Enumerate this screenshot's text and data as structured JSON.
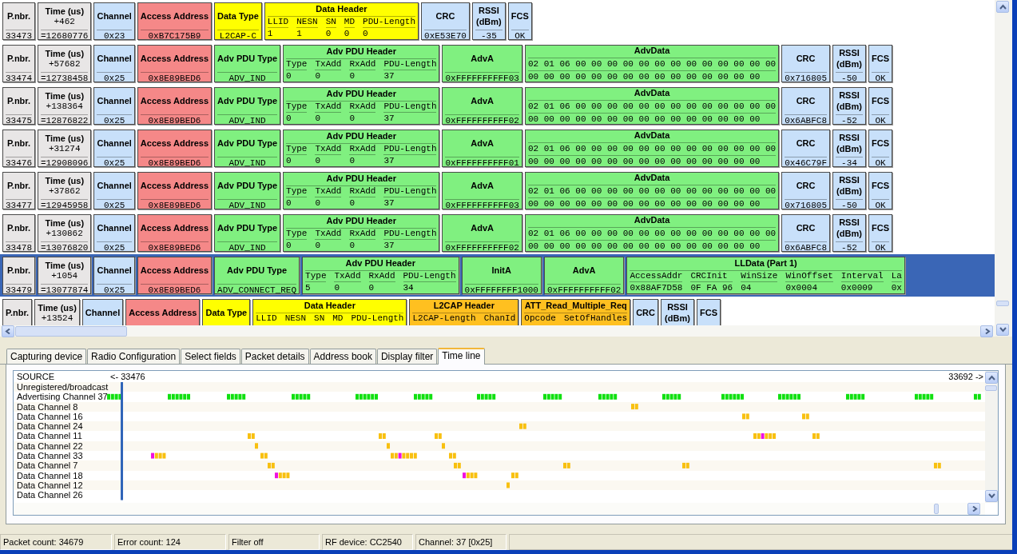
{
  "packets": [
    {
      "selected": false,
      "fields": [
        {
          "kind": "plain",
          "color": "#e8e6e6",
          "title": "P.nbr.",
          "value": "33473"
        },
        {
          "kind": "plain",
          "color": "#e8e6e6",
          "title": "Time (us)",
          "lines": [
            "+462"
          ],
          "value": "=12680776"
        },
        {
          "kind": "plain",
          "color": "#c8e0fa",
          "title": "Channel",
          "value": "0x23"
        },
        {
          "kind": "plain",
          "color": "#f58888",
          "title": "Access Address",
          "value": "0xB7C175B9"
        },
        {
          "kind": "plain",
          "color": "#ffff00",
          "title": "Data Type",
          "value": "L2CAP-C"
        },
        {
          "kind": "grid",
          "color": "#ffff00",
          "title": "Data Header",
          "columns": [
            {
              "label": "LLID",
              "value": "1"
            },
            {
              "label": "NESN",
              "value": "1"
            },
            {
              "label": "SN",
              "value": "0"
            },
            {
              "label": "MD",
              "value": "0"
            },
            {
              "label": "PDU-Length",
              "value": "0"
            }
          ]
        },
        {
          "kind": "plain",
          "color": "#c8e0fa",
          "title": "CRC",
          "value": "0xE53E70"
        },
        {
          "kind": "plain",
          "color": "#c8e0fa",
          "title": "RSSI (dBm)",
          "value": "-35"
        },
        {
          "kind": "plain",
          "color": "#c8e0fa",
          "title": "FCS",
          "value": "OK"
        }
      ]
    },
    {
      "selected": false,
      "fields": [
        {
          "kind": "plain",
          "color": "#e8e6e6",
          "title": "P.nbr.",
          "value": "33474"
        },
        {
          "kind": "plain",
          "color": "#e8e6e6",
          "title": "Time (us)",
          "lines": [
            "+57682"
          ],
          "value": "=12738458"
        },
        {
          "kind": "plain",
          "color": "#c8e0fa",
          "title": "Channel",
          "value": "0x25"
        },
        {
          "kind": "plain",
          "color": "#f58888",
          "title": "Access Address",
          "value": "0x8E89BED6"
        },
        {
          "kind": "plain",
          "color": "#80f080",
          "title": "Adv PDU Type",
          "value": "ADV_IND"
        },
        {
          "kind": "grid",
          "color": "#80f080",
          "title": "Adv PDU Header",
          "columns": [
            {
              "label": "Type",
              "value": "0"
            },
            {
              "label": "TxAdd",
              "value": "0"
            },
            {
              "label": "RxAdd",
              "value": "0"
            },
            {
              "label": "PDU-Length",
              "value": "37"
            }
          ]
        },
        {
          "kind": "plain",
          "color": "#80f080",
          "title": "AdvA",
          "value": "0xFFFFFFFFFF03"
        },
        {
          "kind": "hex",
          "color": "#80f080",
          "title": "AdvData",
          "lines": [
            "02 01 06 00 00 00 00 00 00 00 00 00 00 00 00 00",
            "00 00 00 00 00 00 00 00 00 00 00 00 00 00 00"
          ]
        },
        {
          "kind": "plain",
          "color": "#c8e0fa",
          "title": "CRC",
          "value": "0x716805"
        },
        {
          "kind": "plain",
          "color": "#c8e0fa",
          "title": "RSSI (dBm)",
          "value": "-50"
        },
        {
          "kind": "plain",
          "color": "#c8e0fa",
          "title": "FCS",
          "value": "OK"
        }
      ]
    },
    {
      "selected": false,
      "fields": [
        {
          "kind": "plain",
          "color": "#e8e6e6",
          "title": "P.nbr.",
          "value": "33475"
        },
        {
          "kind": "plain",
          "color": "#e8e6e6",
          "title": "Time (us)",
          "lines": [
            "+138364"
          ],
          "value": "=12876822"
        },
        {
          "kind": "plain",
          "color": "#c8e0fa",
          "title": "Channel",
          "value": "0x25"
        },
        {
          "kind": "plain",
          "color": "#f58888",
          "title": "Access Address",
          "value": "0x8E89BED6"
        },
        {
          "kind": "plain",
          "color": "#80f080",
          "title": "Adv PDU Type",
          "value": "ADV_IND"
        },
        {
          "kind": "grid",
          "color": "#80f080",
          "title": "Adv PDU Header",
          "columns": [
            {
              "label": "Type",
              "value": "0"
            },
            {
              "label": "TxAdd",
              "value": "0"
            },
            {
              "label": "RxAdd",
              "value": "0"
            },
            {
              "label": "PDU-Length",
              "value": "37"
            }
          ]
        },
        {
          "kind": "plain",
          "color": "#80f080",
          "title": "AdvA",
          "value": "0xFFFFFFFFFF02"
        },
        {
          "kind": "hex",
          "color": "#80f080",
          "title": "AdvData",
          "lines": [
            "02 01 06 00 00 00 00 00 00 00 00 00 00 00 00 00",
            "00 00 00 00 00 00 00 00 00 00 00 00 00 00 00"
          ]
        },
        {
          "kind": "plain",
          "color": "#c8e0fa",
          "title": "CRC",
          "value": "0x6ABFC8"
        },
        {
          "kind": "plain",
          "color": "#c8e0fa",
          "title": "RSSI (dBm)",
          "value": "-52"
        },
        {
          "kind": "plain",
          "color": "#c8e0fa",
          "title": "FCS",
          "value": "OK"
        }
      ]
    },
    {
      "selected": false,
      "fields": [
        {
          "kind": "plain",
          "color": "#e8e6e6",
          "title": "P.nbr.",
          "value": "33476"
        },
        {
          "kind": "plain",
          "color": "#e8e6e6",
          "title": "Time (us)",
          "lines": [
            "+31274"
          ],
          "value": "=12908096"
        },
        {
          "kind": "plain",
          "color": "#c8e0fa",
          "title": "Channel",
          "value": "0x25"
        },
        {
          "kind": "plain",
          "color": "#f58888",
          "title": "Access Address",
          "value": "0x8E89BED6"
        },
        {
          "kind": "plain",
          "color": "#80f080",
          "title": "Adv PDU Type",
          "value": "ADV_IND"
        },
        {
          "kind": "grid",
          "color": "#80f080",
          "title": "Adv PDU Header",
          "columns": [
            {
              "label": "Type",
              "value": "0"
            },
            {
              "label": "TxAdd",
              "value": "0"
            },
            {
              "label": "RxAdd",
              "value": "0"
            },
            {
              "label": "PDU-Length",
              "value": "37"
            }
          ]
        },
        {
          "kind": "plain",
          "color": "#80f080",
          "title": "AdvA",
          "value": "0xFFFFFFFFFF01"
        },
        {
          "kind": "hex",
          "color": "#80f080",
          "title": "AdvData",
          "lines": [
            "02 01 06 00 00 00 00 00 00 00 00 00 00 00 00 00",
            "00 00 00 00 00 00 00 00 00 00 00 00 00 00 00"
          ]
        },
        {
          "kind": "plain",
          "color": "#c8e0fa",
          "title": "CRC",
          "value": "0x46C79F"
        },
        {
          "kind": "plain",
          "color": "#c8e0fa",
          "title": "RSSI (dBm)",
          "value": "-34"
        },
        {
          "kind": "plain",
          "color": "#c8e0fa",
          "title": "FCS",
          "value": "OK"
        }
      ]
    },
    {
      "selected": false,
      "fields": [
        {
          "kind": "plain",
          "color": "#e8e6e6",
          "title": "P.nbr.",
          "value": "33477"
        },
        {
          "kind": "plain",
          "color": "#e8e6e6",
          "title": "Time (us)",
          "lines": [
            "+37862"
          ],
          "value": "=12945958"
        },
        {
          "kind": "plain",
          "color": "#c8e0fa",
          "title": "Channel",
          "value": "0x25"
        },
        {
          "kind": "plain",
          "color": "#f58888",
          "title": "Access Address",
          "value": "0x8E89BED6"
        },
        {
          "kind": "plain",
          "color": "#80f080",
          "title": "Adv PDU Type",
          "value": "ADV_IND"
        },
        {
          "kind": "grid",
          "color": "#80f080",
          "title": "Adv PDU Header",
          "columns": [
            {
              "label": "Type",
              "value": "0"
            },
            {
              "label": "TxAdd",
              "value": "0"
            },
            {
              "label": "RxAdd",
              "value": "0"
            },
            {
              "label": "PDU-Length",
              "value": "37"
            }
          ]
        },
        {
          "kind": "plain",
          "color": "#80f080",
          "title": "AdvA",
          "value": "0xFFFFFFFFFF03"
        },
        {
          "kind": "hex",
          "color": "#80f080",
          "title": "AdvData",
          "lines": [
            "02 01 06 00 00 00 00 00 00 00 00 00 00 00 00 00",
            "00 00 00 00 00 00 00 00 00 00 00 00 00 00 00"
          ]
        },
        {
          "kind": "plain",
          "color": "#c8e0fa",
          "title": "CRC",
          "value": "0x716805"
        },
        {
          "kind": "plain",
          "color": "#c8e0fa",
          "title": "RSSI (dBm)",
          "value": "-50"
        },
        {
          "kind": "plain",
          "color": "#c8e0fa",
          "title": "FCS",
          "value": "OK"
        }
      ]
    },
    {
      "selected": false,
      "fields": [
        {
          "kind": "plain",
          "color": "#e8e6e6",
          "title": "P.nbr.",
          "value": "33478"
        },
        {
          "kind": "plain",
          "color": "#e8e6e6",
          "title": "Time (us)",
          "lines": [
            "+130862"
          ],
          "value": "=13076820"
        },
        {
          "kind": "plain",
          "color": "#c8e0fa",
          "title": "Channel",
          "value": "0x25"
        },
        {
          "kind": "plain",
          "color": "#f58888",
          "title": "Access Address",
          "value": "0x8E89BED6"
        },
        {
          "kind": "plain",
          "color": "#80f080",
          "title": "Adv PDU Type",
          "value": "ADV_IND"
        },
        {
          "kind": "grid",
          "color": "#80f080",
          "title": "Adv PDU Header",
          "columns": [
            {
              "label": "Type",
              "value": "0"
            },
            {
              "label": "TxAdd",
              "value": "0"
            },
            {
              "label": "RxAdd",
              "value": "0"
            },
            {
              "label": "PDU-Length",
              "value": "37"
            }
          ]
        },
        {
          "kind": "plain",
          "color": "#80f080",
          "title": "AdvA",
          "value": "0xFFFFFFFFFF02"
        },
        {
          "kind": "hex",
          "color": "#80f080",
          "title": "AdvData",
          "lines": [
            "02 01 06 00 00 00 00 00 00 00 00 00 00 00 00 00",
            "00 00 00 00 00 00 00 00 00 00 00 00 00 00 00"
          ]
        },
        {
          "kind": "plain",
          "color": "#c8e0fa",
          "title": "CRC",
          "value": "0x6ABFC8"
        },
        {
          "kind": "plain",
          "color": "#c8e0fa",
          "title": "RSSI (dBm)",
          "value": "-52"
        },
        {
          "kind": "plain",
          "color": "#c8e0fa",
          "title": "FCS",
          "value": "OK"
        }
      ]
    },
    {
      "selected": true,
      "fields": [
        {
          "kind": "plain",
          "color": "#e8e6e6",
          "title": "P.nbr.",
          "value": "33479"
        },
        {
          "kind": "plain",
          "color": "#e8e6e6",
          "title": "Time (us)",
          "lines": [
            "+1054"
          ],
          "value": "=13077874"
        },
        {
          "kind": "plain",
          "color": "#c8e0fa",
          "title": "Channel",
          "value": "0x25"
        },
        {
          "kind": "plain",
          "color": "#f58888",
          "title": "Access Address",
          "value": "0x8E89BED6"
        },
        {
          "kind": "plain",
          "color": "#80f080",
          "title": "Adv PDU Type",
          "value": "ADV_CONNECT_REQ"
        },
        {
          "kind": "grid",
          "color": "#80f080",
          "title": "Adv PDU Header",
          "columns": [
            {
              "label": "Type",
              "value": "5"
            },
            {
              "label": "TxAdd",
              "value": "0"
            },
            {
              "label": "RxAdd",
              "value": "0"
            },
            {
              "label": "PDU-Length",
              "value": "34"
            }
          ]
        },
        {
          "kind": "plain",
          "color": "#80f080",
          "title": "InitA",
          "value": "0xFFFFFFFF1000"
        },
        {
          "kind": "plain",
          "color": "#80f080",
          "title": "AdvA",
          "value": "0xFFFFFFFFFF02"
        },
        {
          "kind": "grid",
          "color": "#80f080",
          "title": "LLData (Part 1)",
          "columns": [
            {
              "label": "AccessAddr",
              "value": "0x88AF7D58"
            },
            {
              "label": "CRCInit",
              "value": "0F FA 96"
            },
            {
              "label": "WinSize",
              "value": "04"
            },
            {
              "label": "WinOffset",
              "value": "0x0004"
            },
            {
              "label": "Interval",
              "value": "0x0009"
            },
            {
              "label": "La",
              "value": "0x"
            }
          ]
        }
      ]
    },
    {
      "selected": false,
      "fields": [
        {
          "kind": "plain",
          "color": "#e8e6e6",
          "title": "P.nbr."
        },
        {
          "kind": "plain",
          "color": "#e8e6e6",
          "title": "Time (us)",
          "lines": [
            "+13524"
          ]
        },
        {
          "kind": "plain",
          "color": "#c8e0fa",
          "title": "Channel"
        },
        {
          "kind": "plain",
          "color": "#f58888",
          "title": "Access Address"
        },
        {
          "kind": "plain",
          "color": "#ffff00",
          "title": "Data Type"
        },
        {
          "kind": "grid",
          "color": "#ffff00",
          "title": "Data Header",
          "columns": [
            {
              "label": "LLID"
            },
            {
              "label": "NESN"
            },
            {
              "label": "SN"
            },
            {
              "label": "MD"
            },
            {
              "label": "PDU-Length"
            }
          ]
        },
        {
          "kind": "grid",
          "color": "#ffc020",
          "title": "L2CAP Header",
          "columns": [
            {
              "label": "L2CAP-Length"
            },
            {
              "label": "ChanId"
            }
          ]
        },
        {
          "kind": "grid",
          "color": "#ffc020",
          "title": "ATT_Read_Multiple_Req",
          "columns": [
            {
              "label": "Opcode"
            },
            {
              "label": "SetOfHandles"
            }
          ]
        },
        {
          "kind": "plain",
          "color": "#c8e0fa",
          "title": "CRC"
        },
        {
          "kind": "plain",
          "color": "#c8e0fa",
          "title": "RSSI (dBm)"
        },
        {
          "kind": "plain",
          "color": "#c8e0fa",
          "title": "FCS"
        }
      ]
    }
  ],
  "tabs": [
    {
      "label": "Capturing device",
      "selected": false
    },
    {
      "label": "Radio Configuration",
      "selected": false
    },
    {
      "label": "Select fields",
      "selected": false
    },
    {
      "label": "Packet details",
      "selected": false
    },
    {
      "label": "Address book",
      "selected": false
    },
    {
      "label": "Display filter",
      "selected": false
    },
    {
      "label": "Time line",
      "selected": true
    }
  ],
  "timeline": {
    "source_header": "SOURCE",
    "range_start": "<- 33476",
    "range_end": "33692 ->",
    "sources": [
      "Unregistered/broadcast",
      "Advertising Channel 37",
      "Data Channel 8",
      "Data Channel 16",
      "Data Channel 24",
      "Data Channel 11",
      "Data Channel 22",
      "Data Channel 33",
      "Data Channel 7",
      "Data Channel 18",
      "Data Channel 12",
      "Data Channel 26"
    ]
  },
  "status_bar": [
    "Packet count: 34679",
    "Error count: 124",
    "Filter off",
    "RF device: CC2540",
    "Channel: 37 [0x25]"
  ]
}
